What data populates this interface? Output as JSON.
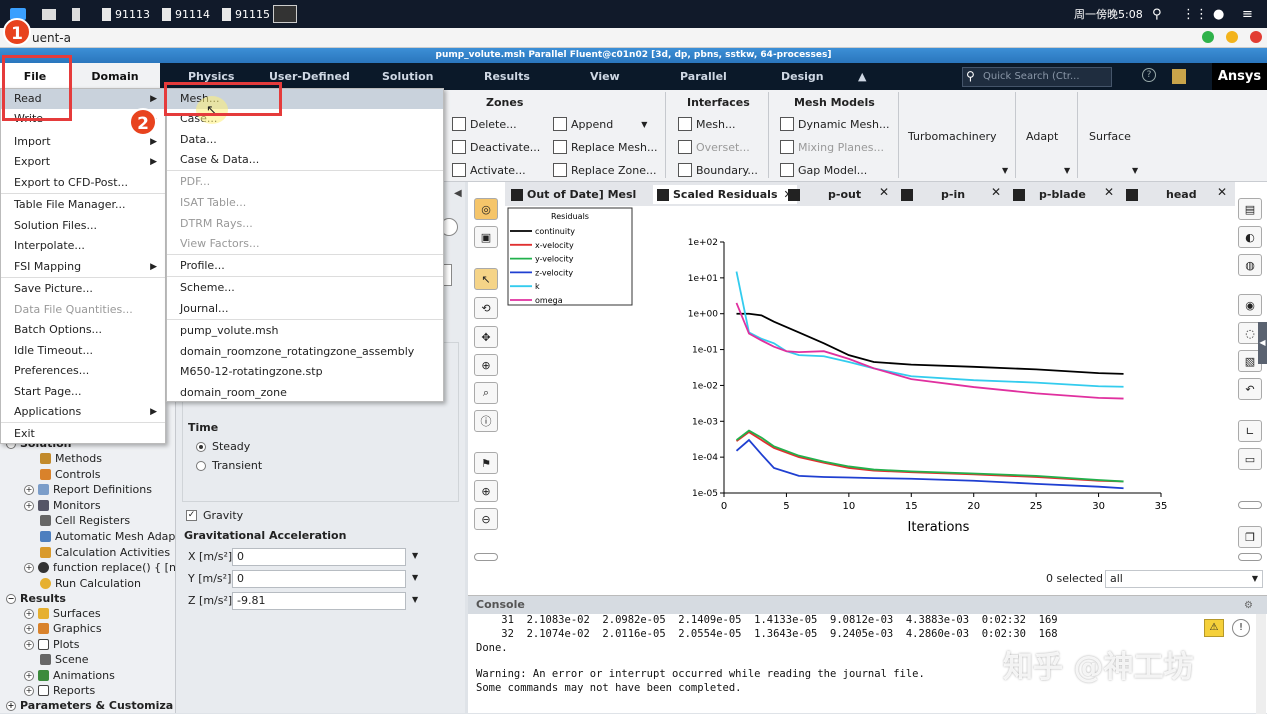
{
  "taskbar": {
    "items": [
      "91113",
      "91114",
      "91115"
    ],
    "clock": "周一傍晚5:08"
  },
  "window": {
    "app_name": "uent-a",
    "title": "pump_volute.msh Parallel Fluent@c01n02  [3d, dp, pbns, sstkw, 64-processes]"
  },
  "menubar": {
    "tabs": [
      "File",
      "Domain",
      "Physics",
      "User-Defined",
      "Solution",
      "Results",
      "View",
      "Parallel",
      "Design"
    ],
    "search_placeholder": "Quick Search (Ctr...",
    "brand": "Ansys"
  },
  "ribbon": {
    "zones_title": "Zones",
    "zones_items": [
      "Delete...",
      "Deactivate...",
      "Activate...",
      "Append",
      "Replace Mesh...",
      "Replace Zone..."
    ],
    "interfaces_title": "Interfaces",
    "interfaces_items": [
      "Mesh...",
      "Overset...",
      "Boundary..."
    ],
    "mesh_models_title": "Mesh Models",
    "mesh_models_items": [
      "Dynamic Mesh...",
      "Mixing Planes...",
      "Gap Model..."
    ],
    "turbo": "Turbomachinery",
    "adapt": "Adapt",
    "surface": "Surface"
  },
  "file_menu": {
    "items": [
      "Read",
      "Write",
      "Import",
      "Export",
      "Export to CFD-Post...",
      "Table File Manager...",
      "Solution Files...",
      "Interpolate...",
      "FSI Mapping",
      "Save Picture...",
      "Data File Quantities...",
      "Batch Options...",
      "Idle Timeout...",
      "Preferences...",
      "Start Page...",
      "Applications",
      "Exit"
    ]
  },
  "read_submenu": {
    "items": [
      "Mesh...",
      "Case...",
      "Data...",
      "Case & Data...",
      "PDF...",
      "ISAT Table...",
      "DTRM Rays...",
      "View Factors...",
      "Profile...",
      "Scheme...",
      "Journal...",
      "pump_volute.msh",
      "domain_roomzone_rotatingzone_assembly",
      "M650-12-rotatingzone.stp",
      "domain_room_zone"
    ]
  },
  "annotations": {
    "step1": "1",
    "step2": "2"
  },
  "tree": {
    "solution_label": "Solution",
    "solution_items": [
      "Methods",
      "Controls",
      "Report Definitions",
      "Monitors",
      "Cell Registers",
      "Automatic Mesh Adap",
      "Calculation Activities",
      "Run Calculation"
    ],
    "results_label": "Results",
    "results_items": [
      "Surfaces",
      "Graphics",
      "Plots",
      "Scene",
      "Animations",
      "Reports"
    ],
    "params_label": "Parameters & Customiza"
  },
  "task_panel": {
    "time_label": "Time",
    "time_options": [
      "Steady",
      "Transient"
    ],
    "gravity_label": "Gravity",
    "grav_accel_label": "Gravitational Acceleration",
    "x_label": "X [m/s²]",
    "y_label": "Y [m/s²]",
    "z_label": "Z [m/s²]",
    "x_value": "0",
    "y_value": "0",
    "z_value": "-9.81"
  },
  "graphics_tabs": [
    "Out of Date] Mesl",
    "Scaled Residuals",
    "p-out",
    "p-in",
    "p-blade",
    "head"
  ],
  "selection": {
    "count_text": "0 selected",
    "filter_value": "all"
  },
  "console": {
    "title": "Console",
    "lines": [
      "    31  2.1083e-02  2.0982e-05  2.1409e-05  1.4133e-05  9.0812e-03  4.3883e-03  0:02:32  169",
      "    32  2.1074e-02  2.0116e-05  2.0554e-05  1.3643e-05  9.2405e-03  4.2860e-03  0:02:30  168",
      "Done.",
      "",
      "Warning: An error or interrupt occurred while reading the journal file.",
      "Some commands may not have been completed."
    ]
  },
  "watermark": "知乎 @神工坊",
  "chart_data": {
    "type": "line",
    "title": "",
    "legend_title": "Residuals",
    "xlabel": "Iterations",
    "ylabel": "",
    "xlim": [
      0,
      35
    ],
    "ylim": [
      1e-05,
      100
    ],
    "yscale": "log",
    "xticks": [
      "0",
      "5",
      "10",
      "15",
      "20",
      "25",
      "30",
      "35"
    ],
    "yticks": [
      "1e-05",
      "1e-04",
      "1e-03",
      "1e-02",
      "1e-01",
      "1e+00",
      "1e+01",
      "1e+02"
    ],
    "legend_position": "top-left",
    "series": [
      {
        "name": "continuity",
        "color": "#000000",
        "x": [
          1,
          2,
          3,
          4,
          6,
          8,
          10,
          12,
          15,
          20,
          25,
          30,
          32
        ],
        "y": [
          1.0,
          1.0,
          0.9,
          0.6,
          0.3,
          0.15,
          0.07,
          0.045,
          0.038,
          0.033,
          0.028,
          0.022,
          0.021
        ]
      },
      {
        "name": "x-velocity",
        "color": "#e03030",
        "x": [
          1,
          2,
          3,
          4,
          6,
          8,
          10,
          12,
          15,
          20,
          25,
          30,
          32
        ],
        "y": [
          0.00028,
          0.0005,
          0.0003,
          0.00018,
          0.0001,
          7e-05,
          5e-05,
          4.2e-05,
          3.8e-05,
          3.3e-05,
          2.8e-05,
          2.2e-05,
          2.1e-05
        ]
      },
      {
        "name": "y-velocity",
        "color": "#22b14c",
        "x": [
          1,
          2,
          3,
          4,
          6,
          8,
          10,
          12,
          15,
          20,
          25,
          30,
          32
        ],
        "y": [
          0.0003,
          0.00055,
          0.00035,
          0.0002,
          0.00011,
          7.5e-05,
          5.5e-05,
          4.5e-05,
          4e-05,
          3.5e-05,
          3e-05,
          2.3e-05,
          2.1e-05
        ]
      },
      {
        "name": "z-velocity",
        "color": "#1f3fd1",
        "x": [
          1,
          2,
          3,
          4,
          6,
          8,
          10,
          12,
          15,
          20,
          25,
          30,
          32
        ],
        "y": [
          0.00015,
          0.0003,
          0.00012,
          5e-05,
          3e-05,
          2.8e-05,
          2.7e-05,
          2.6e-05,
          2.5e-05,
          2.2e-05,
          1.8e-05,
          1.5e-05,
          1.36e-05
        ]
      },
      {
        "name": "k",
        "color": "#33ccee",
        "x": [
          1,
          2,
          3,
          4,
          5,
          6,
          8,
          10,
          12,
          15,
          20,
          25,
          30,
          32
        ],
        "y": [
          15,
          0.3,
          0.2,
          0.15,
          0.09,
          0.07,
          0.065,
          0.045,
          0.03,
          0.018,
          0.014,
          0.012,
          0.0095,
          0.0092
        ]
      },
      {
        "name": "omega",
        "color": "#e0309f",
        "x": [
          1,
          2,
          3,
          4,
          5,
          6,
          8,
          10,
          12,
          15,
          20,
          25,
          30,
          32
        ],
        "y": [
          2.0,
          0.28,
          0.18,
          0.12,
          0.09,
          0.085,
          0.09,
          0.055,
          0.03,
          0.015,
          0.009,
          0.006,
          0.0045,
          0.0043
        ]
      }
    ]
  }
}
